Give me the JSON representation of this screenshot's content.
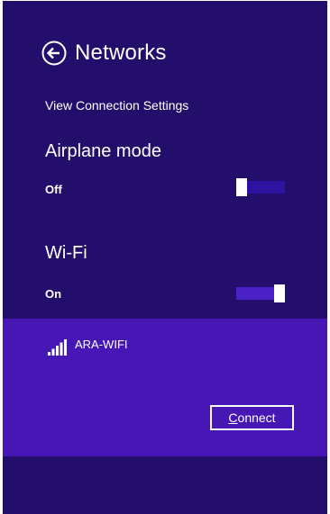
{
  "header": {
    "title": "Networks",
    "back_icon": "back-arrow-circle-icon"
  },
  "view_connection_settings": "View Connection Settings",
  "airplane_mode": {
    "title": "Airplane mode",
    "state": "Off",
    "on": false
  },
  "wifi": {
    "title": "Wi-Fi",
    "state": "On",
    "on": true
  },
  "networks": [
    {
      "name": "ARA-WIFI",
      "signal_icon": "wifi-signal-bars-icon",
      "connect_label": "Connect",
      "connect_access_key": "C"
    }
  ],
  "colors": {
    "panel_background": "#230f6b",
    "selected_network_background": "#4617b4",
    "toggle_track_off": "#2c14a0",
    "toggle_track_on": "#4a22c6",
    "text": "#ffffff"
  }
}
